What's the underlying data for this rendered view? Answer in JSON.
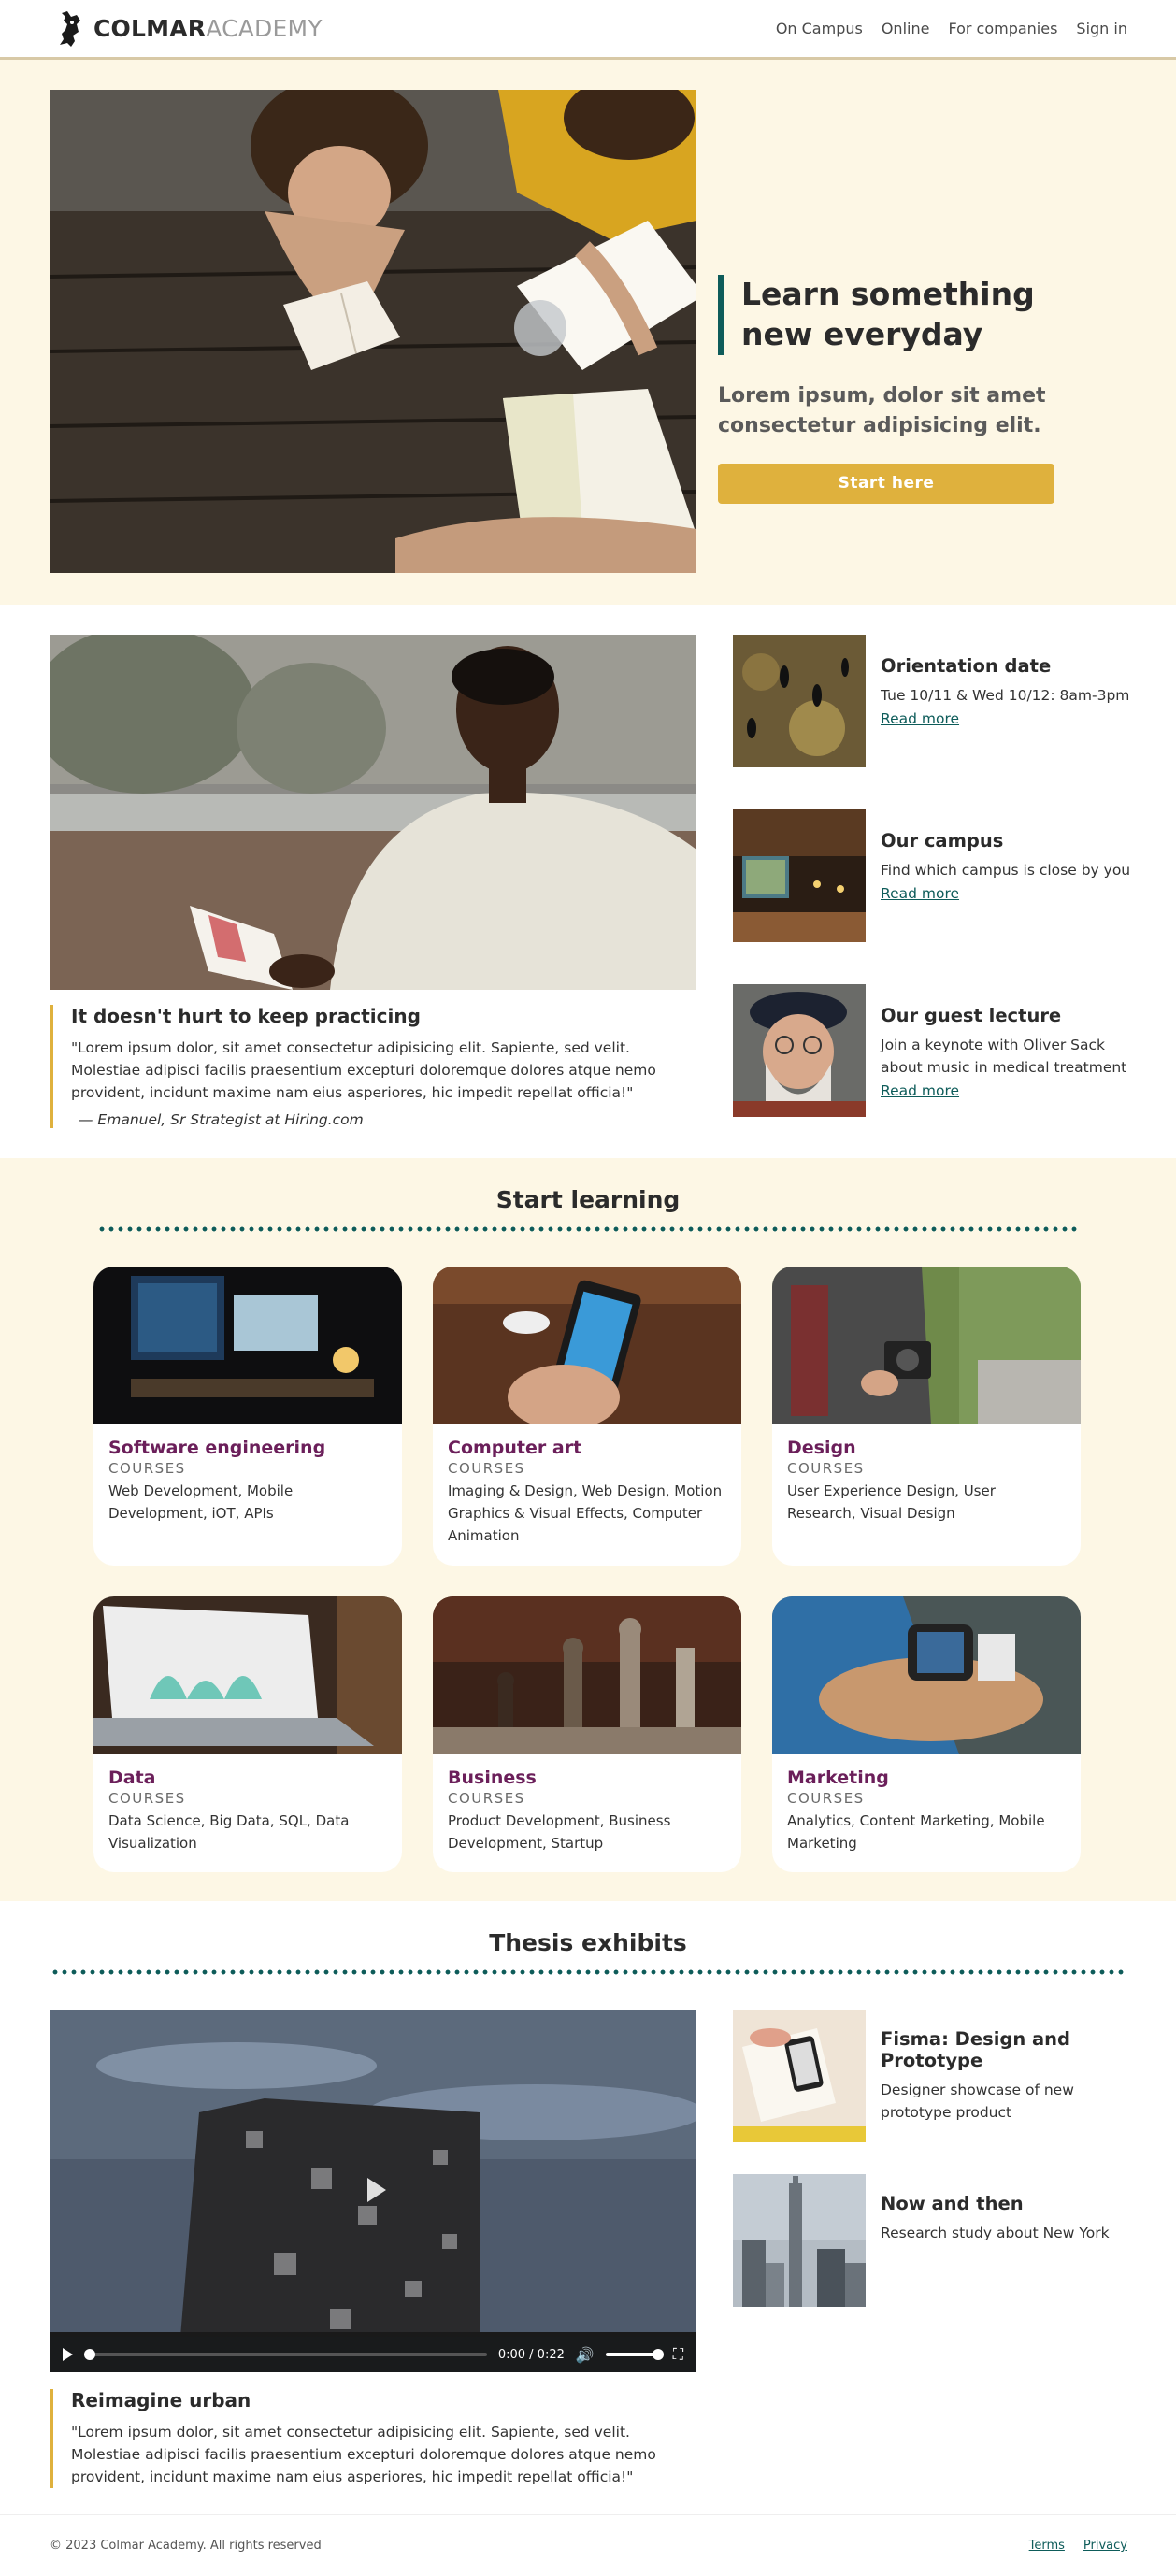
{
  "header": {
    "logo_bold": "COLMAR",
    "logo_light": "ACADEMY",
    "nav": [
      "On Campus",
      "Online",
      "For companies",
      "Sign in"
    ]
  },
  "hero": {
    "title": "Learn something new everyday",
    "subtitle": "Lorem ipsum, dolor sit amet consectetur adipisicing elit.",
    "cta": "Start here"
  },
  "featured": {
    "title": "It doesn't hurt to keep practicing",
    "quote": "\"Lorem ipsum dolor, sit amet consectetur adipisicing elit. Sapiente, sed velit. Molestiae adipisci facilis praesentium excepturi doloremque dolores atque nemo provident, incidunt maxime nam eius asperiores, hic impedit repellat officia!\"",
    "author": "— Emanuel, Sr Strategist at Hiring.com"
  },
  "events": [
    {
      "title": "Orientation date",
      "desc": "Tue 10/11 & Wed 10/12: 8am-3pm",
      "link": "Read more"
    },
    {
      "title": "Our campus",
      "desc": "Find which campus is close by you",
      "link": "Read more"
    },
    {
      "title": "Our guest lecture",
      "desc": "Join a keynote with Oliver Sack about music in medical treatment",
      "link": "Read more"
    }
  ],
  "learning": {
    "title": "Start learning",
    "cards": [
      {
        "title": "Software engineering",
        "kicker": "COURSES",
        "desc": "Web Development, Mobile Development, iOT, APIs"
      },
      {
        "title": "Computer art",
        "kicker": "COURSES",
        "desc": "Imaging & Design, Web Design, Motion Graphics & Visual Effects, Computer Animation"
      },
      {
        "title": "Design",
        "kicker": "COURSES",
        "desc": "User Experience Design, User Research, Visual Design"
      },
      {
        "title": "Data",
        "kicker": "COURSES",
        "desc": "Data Science, Big Data, SQL, Data Visualization"
      },
      {
        "title": "Business",
        "kicker": "COURSES",
        "desc": "Product Development, Business Development, Startup"
      },
      {
        "title": "Marketing",
        "kicker": "COURSES",
        "desc": "Analytics, Content Marketing, Mobile Marketing"
      }
    ]
  },
  "thesis": {
    "title": "Thesis exhibits",
    "video_time": "0:00 / 0:22",
    "quote_title": "Reimagine urban",
    "quote": "\"Lorem ipsum dolor, sit amet consectetur adipisicing elit. Sapiente, sed velit. Molestiae adipisci facilis praesentium excepturi doloremque dolores atque nemo provident, incidunt maxime nam eius asperiores, hic impedit repellat officia!\"",
    "exhibits": [
      {
        "title": "Fisma: Design and Prototype",
        "desc": "Designer showcase of new prototype product"
      },
      {
        "title": "Now and then",
        "desc": "Research study about New York"
      }
    ]
  },
  "footer": {
    "copyright": "© 2023 Colmar Academy. All rights reserved",
    "terms": "Terms",
    "privacy": "Privacy"
  },
  "colors": {
    "accent_teal": "#0e5c5a",
    "accent_gold": "#dfb13d",
    "cream": "#fdf7e5",
    "card_title": "#6b1f5a"
  }
}
